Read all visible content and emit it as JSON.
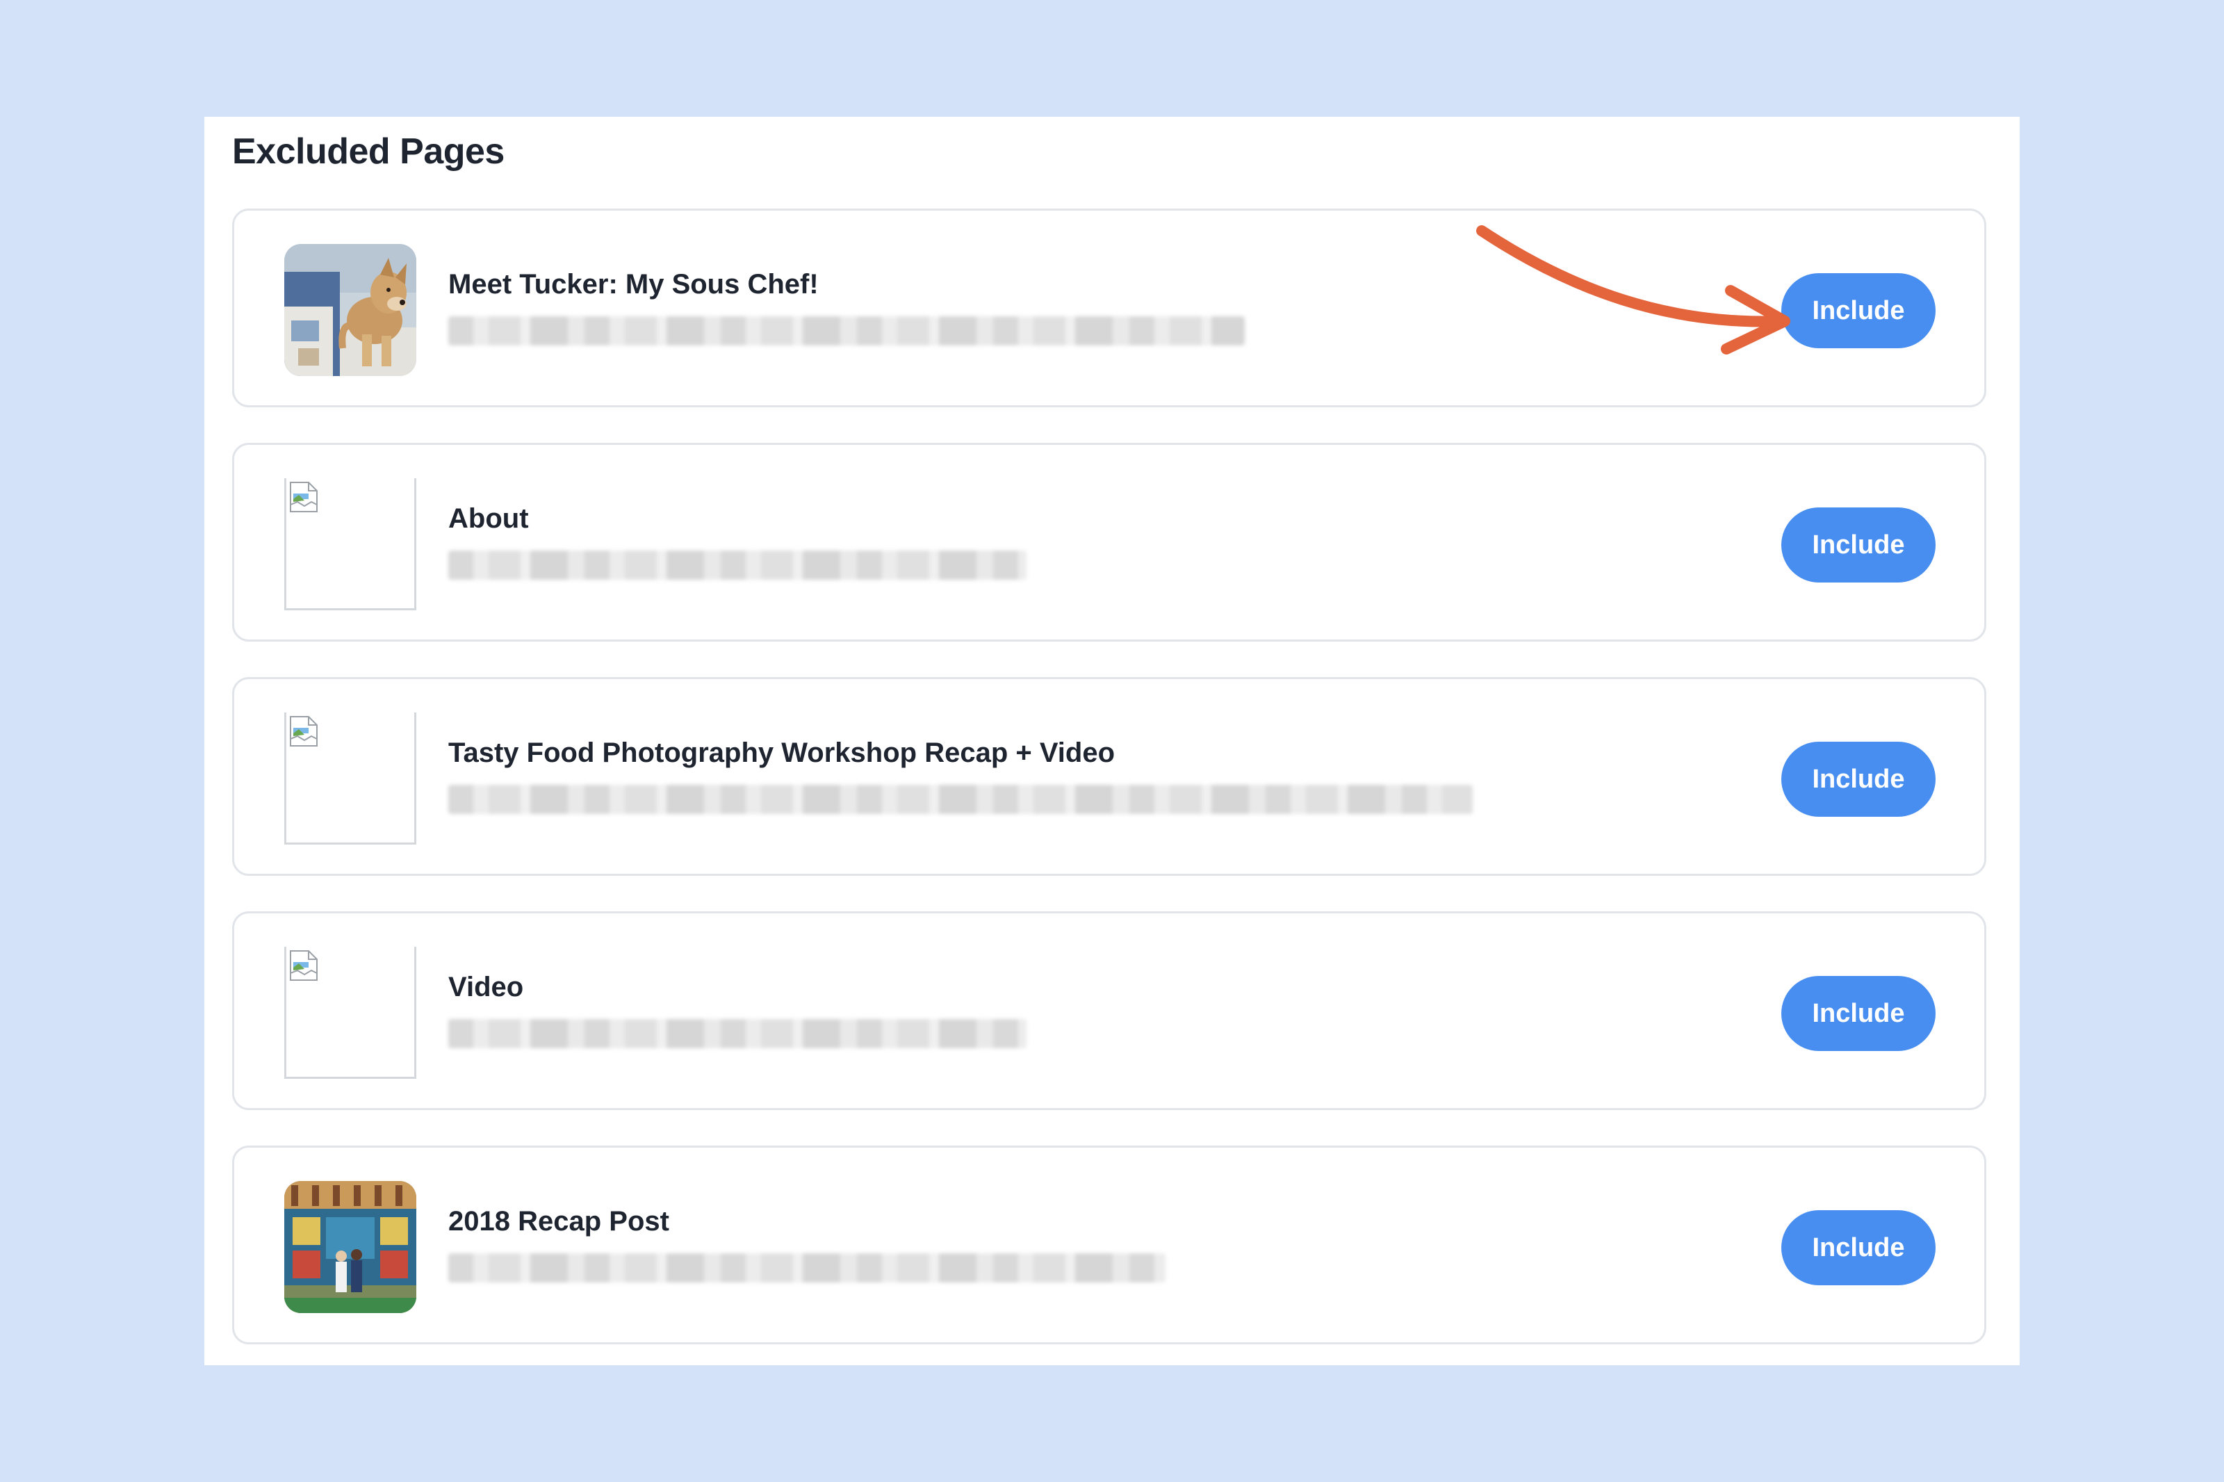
{
  "panel": {
    "title": "Excluded Pages"
  },
  "pages": [
    {
      "title": "Meet Tucker: My Sous Chef!",
      "url": "",
      "thumbnail": "dog-photo",
      "button_label": "Include"
    },
    {
      "title": "About",
      "url": "",
      "thumbnail": "broken-image-icon",
      "button_label": "Include"
    },
    {
      "title": "Tasty Food Photography Workshop Recap + Video",
      "url": "",
      "thumbnail": "broken-image-icon",
      "button_label": "Include"
    },
    {
      "title": "Video",
      "url": "",
      "thumbnail": "broken-image-icon",
      "button_label": "Include"
    },
    {
      "title": "2018 Recap Post",
      "url": "",
      "thumbnail": "tiled-plaza-photo",
      "button_label": "Include"
    }
  ],
  "colors": {
    "background": "#d3e2f9",
    "button": "#478ef0",
    "annotation_arrow": "#e4643b"
  }
}
